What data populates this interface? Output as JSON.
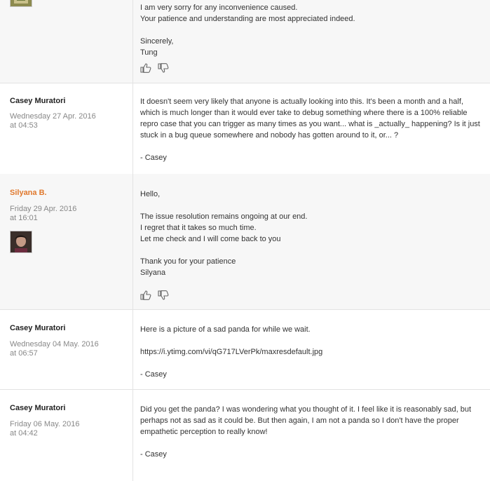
{
  "posts": [
    {
      "author": "",
      "date": "",
      "paragraphs": [
        [
          "I am very sorry for any inconvenience caused.",
          "Your patience and understanding are most appreciated indeed."
        ],
        [
          "Sincerely,",
          "Tung"
        ]
      ]
    },
    {
      "author": "Casey Muratori",
      "date": "Wednesday 27 Apr. 2016",
      "time": "at 04:53",
      "paragraphs": [
        [
          "It doesn't seem very likely that anyone is actually looking into this. It's been a month and a half, which is much longer than it would ever take to debug something where there is a 100% reliable repro case that you can trigger as many times as you want... what is _actually_ happening? Is it just stuck in a bug queue somewhere and nobody has gotten around to it, or... ?"
        ],
        [
          "- Casey"
        ]
      ]
    },
    {
      "author": "Silyana B.",
      "date": "Friday 29 Apr. 2016",
      "time": "at 16:01",
      "paragraphs": [
        [
          "Hello,"
        ],
        [
          "The issue resolution remains ongoing at our end.",
          "I regret that it takes so much time.",
          "Let me check and I will come back to you"
        ],
        [
          "Thank you for your patience",
          "Silyana"
        ]
      ]
    },
    {
      "author": "Casey Muratori",
      "date": "Wednesday 04 May. 2016",
      "time": "at 06:57",
      "paragraphs": [
        [
          "Here is a picture of a sad panda for while we wait."
        ],
        [
          "https://i.ytimg.com/vi/qG717LVerPk/maxresdefault.jpg"
        ],
        [
          "- Casey"
        ]
      ]
    },
    {
      "author": "Casey Muratori",
      "date": "Friday 06 May. 2016",
      "time": "at 04:42",
      "paragraphs": [
        [
          "Did you get the panda? I was wondering what you thought of it. I feel like it is reasonably sad, but perhaps not as sad as it could be. But then again, I am not a panda so I don't have the proper empathetic perception to really know!"
        ],
        [
          "- Casey"
        ]
      ]
    }
  ],
  "icons": {
    "like": "thumbs-up-icon",
    "dislike": "thumbs-down-icon"
  },
  "colors": {
    "staff_name": "#e0782c",
    "staff_background": "#f7f7f7"
  }
}
